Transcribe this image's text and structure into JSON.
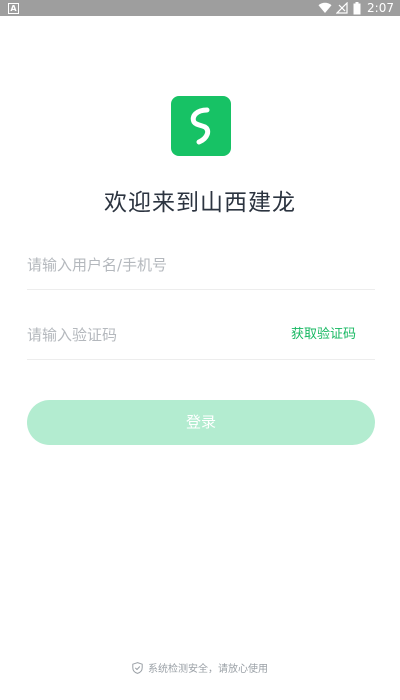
{
  "status_bar": {
    "left_icon": "A",
    "time": "2:07",
    "icons": [
      "wifi-icon",
      "signal-icon",
      "battery-icon"
    ]
  },
  "app_icon": "app-logo-icon",
  "welcome_title": "欢迎来到山西建龙",
  "username": {
    "placeholder": "请输入用户名/手机号",
    "value": ""
  },
  "code": {
    "placeholder": "请输入验证码",
    "value": "",
    "get_code_label": "获取验证码"
  },
  "login_button": "登录",
  "security_note": "系统检测安全，请放心使用",
  "colors": {
    "brand_green": "#17c265",
    "link_green": "#17b862",
    "button_disabled": "#b3ecd0",
    "status_bar": "#9e9e9e"
  }
}
